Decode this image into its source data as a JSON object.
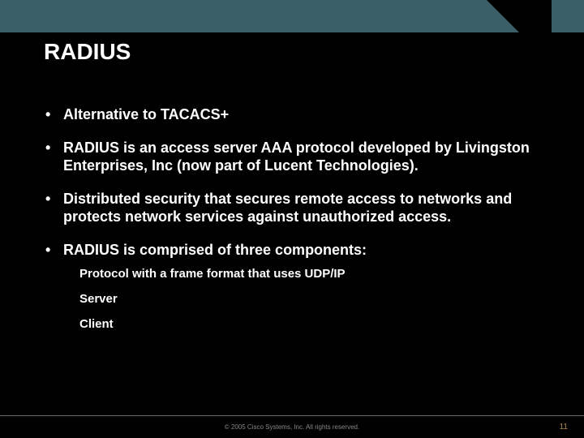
{
  "header": {
    "title": "RADIUS"
  },
  "bullets": {
    "b0": "Alternative to TACACS+",
    "b1": "RADIUS is an access server AAA protocol developed by Livingston Enterprises, Inc (now part of Lucent Technologies).",
    "b2": "Distributed security that secures remote access to networks and protects network services against unauthorized access.",
    "b3": "RADIUS is comprised of three components:"
  },
  "sub": {
    "s0": "Protocol with a frame format that uses UDP/IP",
    "s1": "Server",
    "s2": "Client"
  },
  "footer": {
    "copyright": "© 2005 Cisco Systems, Inc. All rights reserved.",
    "page": "11"
  },
  "colors": {
    "teal": "#3a5f66",
    "bg": "#000000",
    "text": "#ffffff",
    "pageNum": "#b08850"
  }
}
